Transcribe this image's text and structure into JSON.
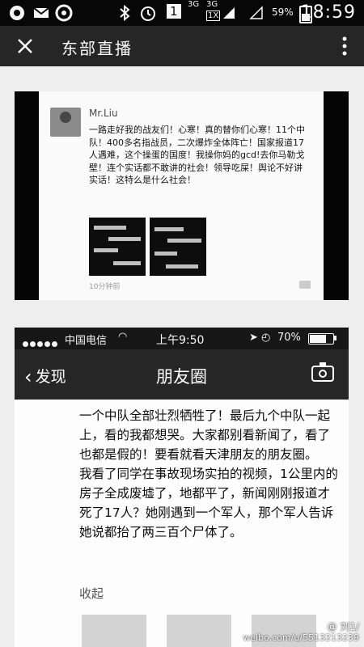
{
  "status_bar": {
    "signal_label": "3G",
    "signal_label2": "3G",
    "network_label": "1X",
    "battery": "59%",
    "time": "18:59",
    "sim_label": "1"
  },
  "top_bar": {
    "title": "东部直播"
  },
  "photo1": {
    "author": "Mr.Liu",
    "post_text": "一路走好我的战友们！心寒！真的替你们心寒！11个中队！400多名指战员，二次爆炸全体阵亡！国家报道17人遇难，这个操蛋的国度！我操你妈的gcd!去你马勒戈壁！连个实话都不敢讲的社会！领导吃屎！舆论不好讲实话！这特么是什么社会！",
    "timestamp": "10分钟前"
  },
  "photo2": {
    "ios_carrier": "中国电信",
    "ios_time": "上午9:50",
    "ios_battery": "70%",
    "nav_back": "发现",
    "nav_title": "朋友圈",
    "paragraph1": "一个中队全部壮烈牺牲了！最后九个中队一起上，看的我都想哭。大家都别看新闻了，看了也都是假的！要看就看天津朋友的朋友圈。",
    "paragraph2": "我看了同学在事故现场实拍的视频，1公里内的房子全成废墟了，地都平了，新闻刚刚报道才死了17人？她刚遇到一个军人，那个军人告诉她说都抬了两三百个尸体了。",
    "collapse": "收起"
  },
  "watermark": {
    "handle": "@ 刘1/",
    "url": "weibo.com/u/5513213239"
  },
  "colors": {
    "status_bar": "#0d0d0d",
    "top_bar": "#2a2a2a",
    "nav_bar": "#2a2a2a",
    "page_bg": "#e9e9e9"
  }
}
